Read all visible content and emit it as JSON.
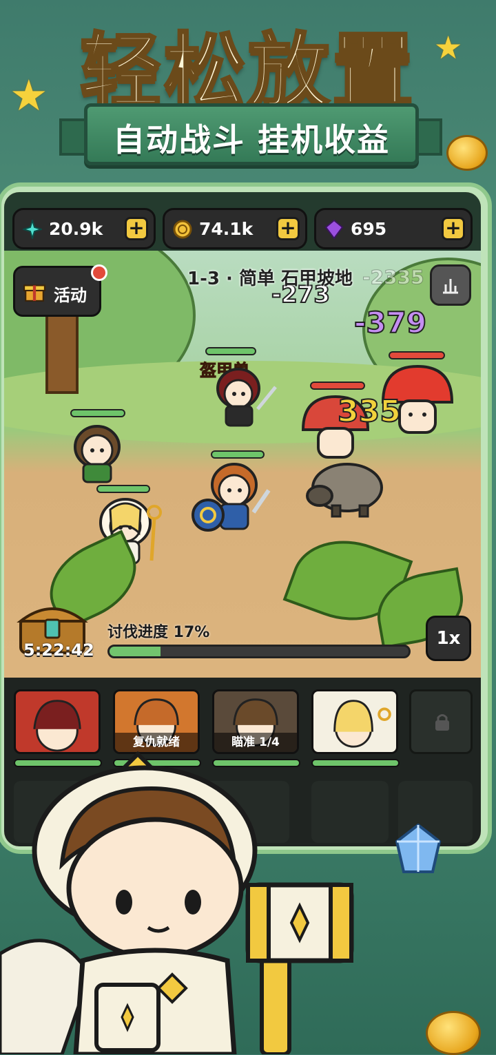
{
  "headline": "轻松放置",
  "subtitle": "自动战斗  挂机收益",
  "resources": [
    {
      "icon": "sparkle-icon",
      "value": "20.9k"
    },
    {
      "icon": "gold-coin-icon",
      "value": "74.1k"
    },
    {
      "icon": "purple-gem-icon",
      "value": "695"
    }
  ],
  "plus_label": "+",
  "activity": {
    "label": "活动",
    "icon": "gift-icon"
  },
  "stage_label": "1-3 · 简单 石甲坡地",
  "damage_numbers": {
    "enemy1": "-273",
    "enemy2": "-379",
    "faded": "-2335",
    "hit": "335"
  },
  "mob_name": "盔甲兽",
  "chest_timer": "5:22:42",
  "progress": {
    "label": "讨伐进度 17%",
    "percent": 17
  },
  "speed_label": "1x",
  "hero_cards": [
    {
      "label": "",
      "color": "#c0392b"
    },
    {
      "label": "复仇就绪",
      "color": "#d2772e"
    },
    {
      "label": "瞄准 1/4",
      "color": "#5a4a3a"
    },
    {
      "label": "",
      "color": "#f4f0e2"
    }
  ],
  "colors": {
    "accent": "#f2c940",
    "hp": "#6ec46a",
    "frame": "#bfe3b9"
  }
}
